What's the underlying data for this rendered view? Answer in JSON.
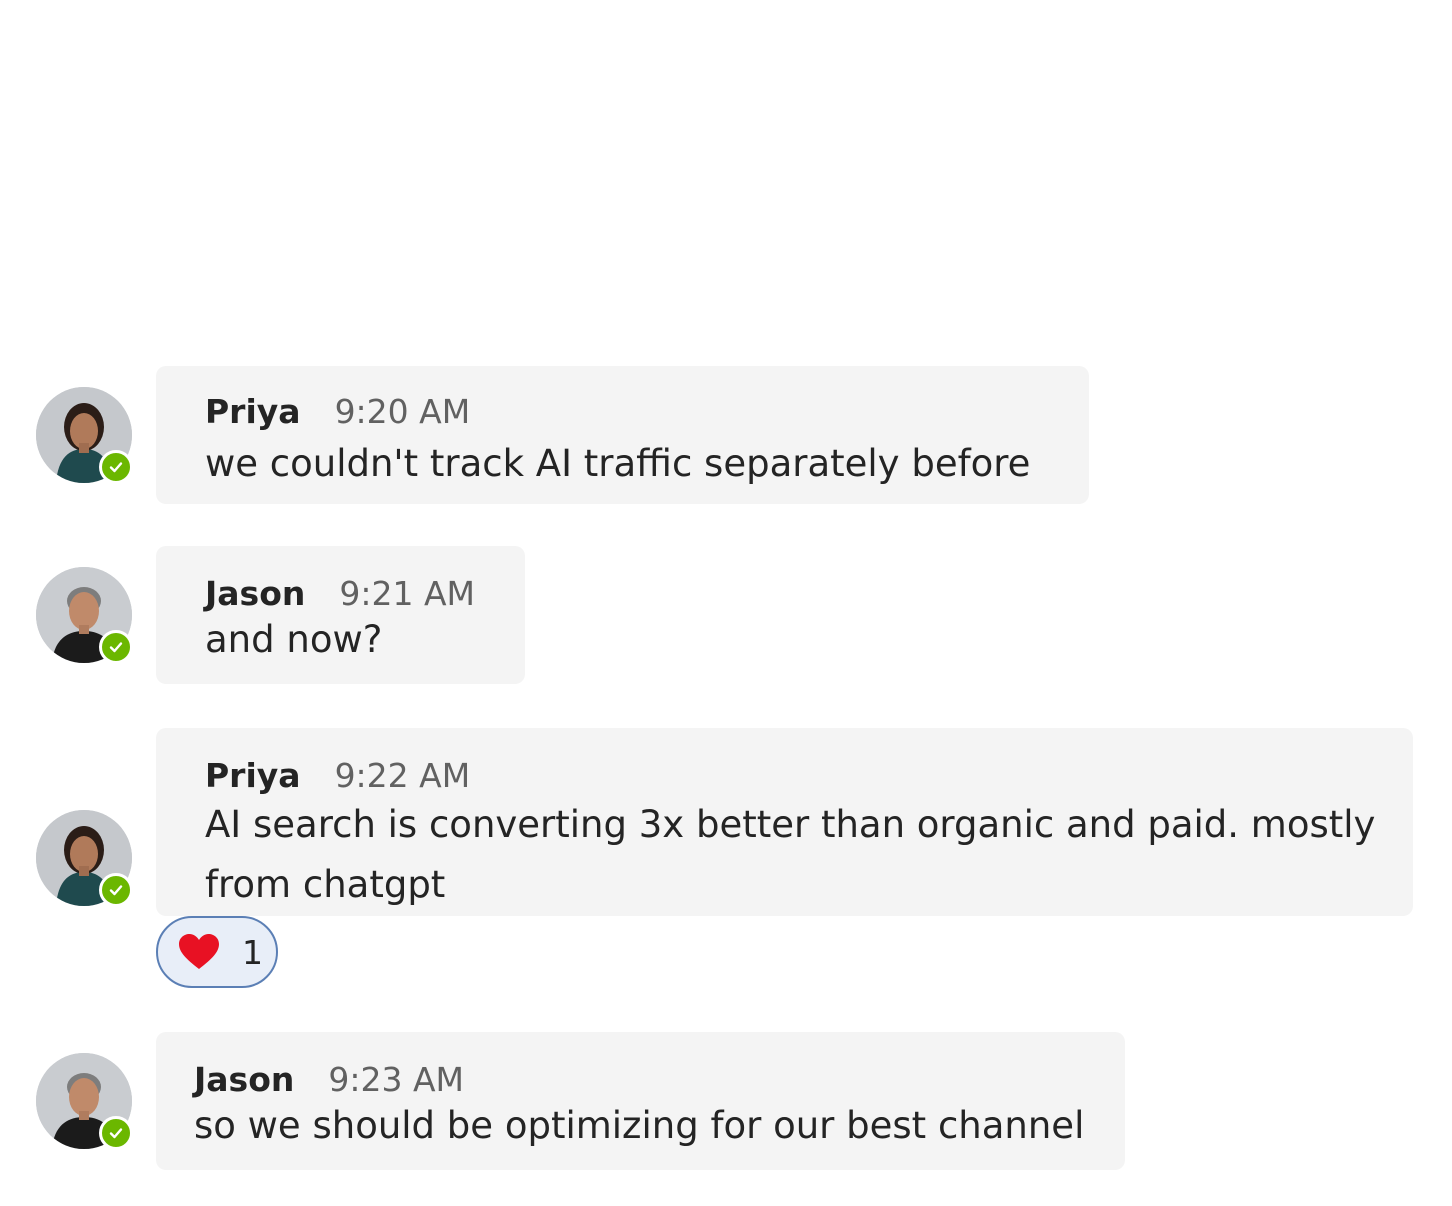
{
  "messages": [
    {
      "author": "Priya",
      "time": "9:20 AM",
      "lines": [
        "we couldn't track AI traffic separately before"
      ]
    },
    {
      "author": "Jason",
      "time": "9:21 AM",
      "lines": [
        "and now?"
      ]
    },
    {
      "author": "Priya",
      "time": "9:22 AM",
      "lines": [
        "AI search is converting 3x better than organic and paid. mostly",
        "from chatgpt"
      ]
    },
    {
      "author": "Jason",
      "time": "9:23 AM",
      "lines": [
        "so we should be optimizing for our best channel"
      ]
    }
  ],
  "reaction": {
    "icon": "heart-icon",
    "count": "1",
    "color": "#e81123"
  },
  "colors": {
    "presence": "#6bb700",
    "bubble": "#f4f4f4"
  },
  "presence_status": "available"
}
